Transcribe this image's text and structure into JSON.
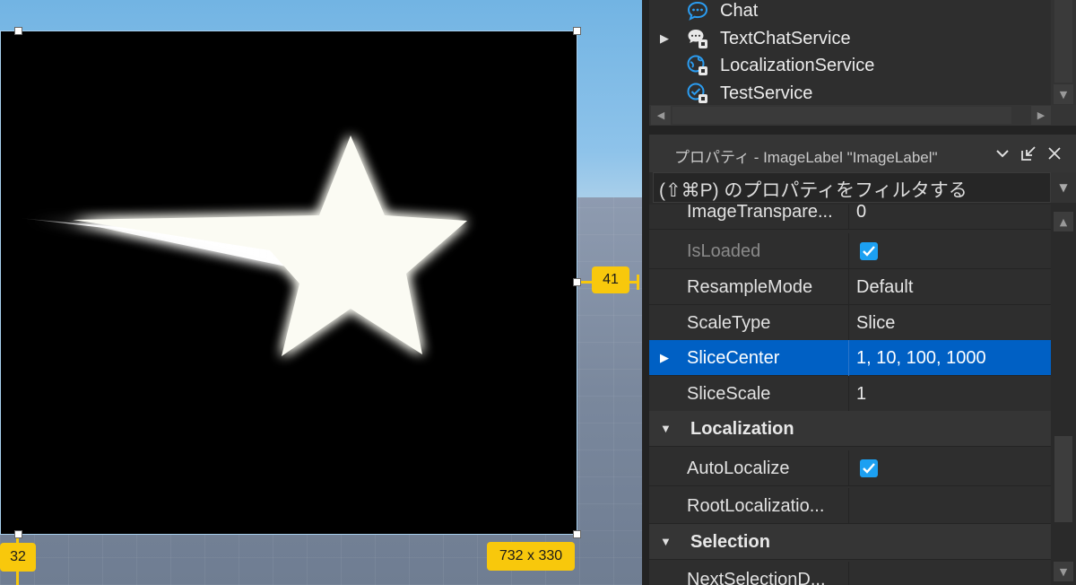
{
  "viewport": {
    "size_label": "732 x 330",
    "offset_right": "41",
    "offset_bottom": "32"
  },
  "explorer": {
    "items": [
      {
        "label": "Chat",
        "icon": "chat-icon",
        "expandable": false
      },
      {
        "label": "TextChatService",
        "icon": "text-chat-service-icon",
        "expandable": true
      },
      {
        "label": "LocalizationService",
        "icon": "localization-service-icon",
        "expandable": false
      },
      {
        "label": "TestService",
        "icon": "test-service-icon",
        "expandable": false
      }
    ]
  },
  "properties": {
    "title": "プロパティ - ImageLabel \"ImageLabel\"",
    "filter_placeholder": "(⇧⌘P) のプロパティをフィルタする",
    "rows": [
      {
        "name": "ImageTranspare...",
        "value": "0"
      },
      {
        "name": "IsLoaded",
        "checked": true,
        "dim": true
      },
      {
        "name": "ResampleMode",
        "value": "Default"
      },
      {
        "name": "ScaleType",
        "value": "Slice"
      },
      {
        "name": "SliceCenter",
        "value": "1, 10, 100, 1000",
        "selected": true
      },
      {
        "name": "SliceScale",
        "value": "1"
      },
      {
        "name": "Localization",
        "category": true
      },
      {
        "name": "AutoLocalize",
        "checked": true
      },
      {
        "name": "RootLocalizatio...",
        "value": ""
      },
      {
        "name": "Selection",
        "category": true
      },
      {
        "name": "NextSelectionD...",
        "value": ""
      }
    ]
  },
  "colors": {
    "selection_blue": "#0060c4",
    "checkbox_blue": "#1ca0f2",
    "tag_yellow": "#f8c80c",
    "chat_blue": "#2b9cf0"
  }
}
